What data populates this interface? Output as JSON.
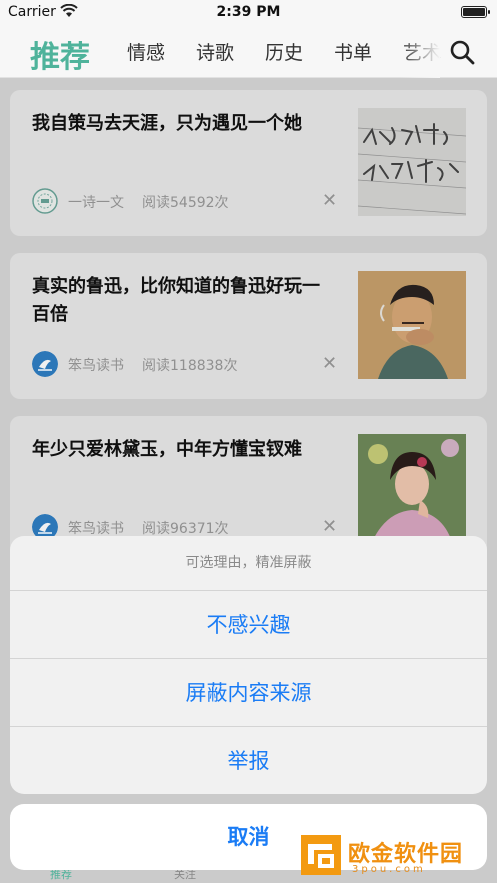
{
  "status_bar": {
    "carrier": "Carrier",
    "time": "2:39 PM"
  },
  "nav": {
    "tabs": [
      {
        "label": "推荐",
        "active": true
      },
      {
        "label": "情感"
      },
      {
        "label": "诗歌"
      },
      {
        "label": "历史"
      },
      {
        "label": "书单"
      },
      {
        "label": "艺术"
      }
    ],
    "accent_color": "#4fb39b"
  },
  "feed": [
    {
      "title": "我自策马去天涯，只为遇见一个她",
      "source": "一诗一文",
      "reads": "阅读54592次",
      "thumb": "handwriting-image"
    },
    {
      "title": "真实的鲁迅，比你知道的鲁迅好玩一百倍",
      "source": "笨鸟读书",
      "reads": "阅读118838次",
      "thumb": "luxun-portrait-image"
    },
    {
      "title": "年少只爱林黛玉，中年方懂宝钗难",
      "source": "笨鸟读书",
      "reads": "阅读96371次",
      "thumb": "actress-portrait-image"
    }
  ],
  "action_sheet": {
    "title": "可选理由，精准屏蔽",
    "options": [
      "不感兴趣",
      "屏蔽内容来源",
      "举报"
    ],
    "cancel": "取消",
    "option_color": "#1a7cf5"
  },
  "tab_bar": {
    "home_label": "推荐",
    "follow_label": "关注"
  },
  "watermark": {
    "text": "欧金软件园",
    "sub": "3pou.com"
  }
}
